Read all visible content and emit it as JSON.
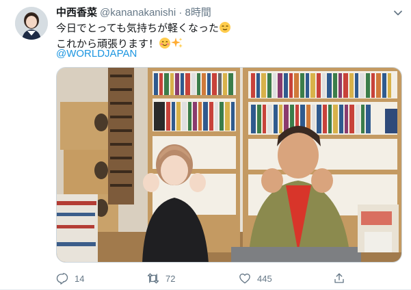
{
  "tweet": {
    "display_name": "中西香菜",
    "handle": "@kananakanishi",
    "separator": "·",
    "time": "8時間",
    "line1": "今日でとっても気持ちが軽くなった",
    "line2": "これから頑張ります！",
    "mention": "@WORLDJAPAN"
  },
  "actions": {
    "reply_count": "14",
    "retweet_count": "72",
    "like_count": "445"
  },
  "icons": {
    "more": "chevron-down-icon",
    "reply": "reply-icon",
    "retweet": "retweet-icon",
    "like": "heart-icon",
    "share": "share-icon"
  },
  "colors": {
    "link": "#1b95e0",
    "secondary_text": "#657786",
    "action_icon": "#657786"
  }
}
